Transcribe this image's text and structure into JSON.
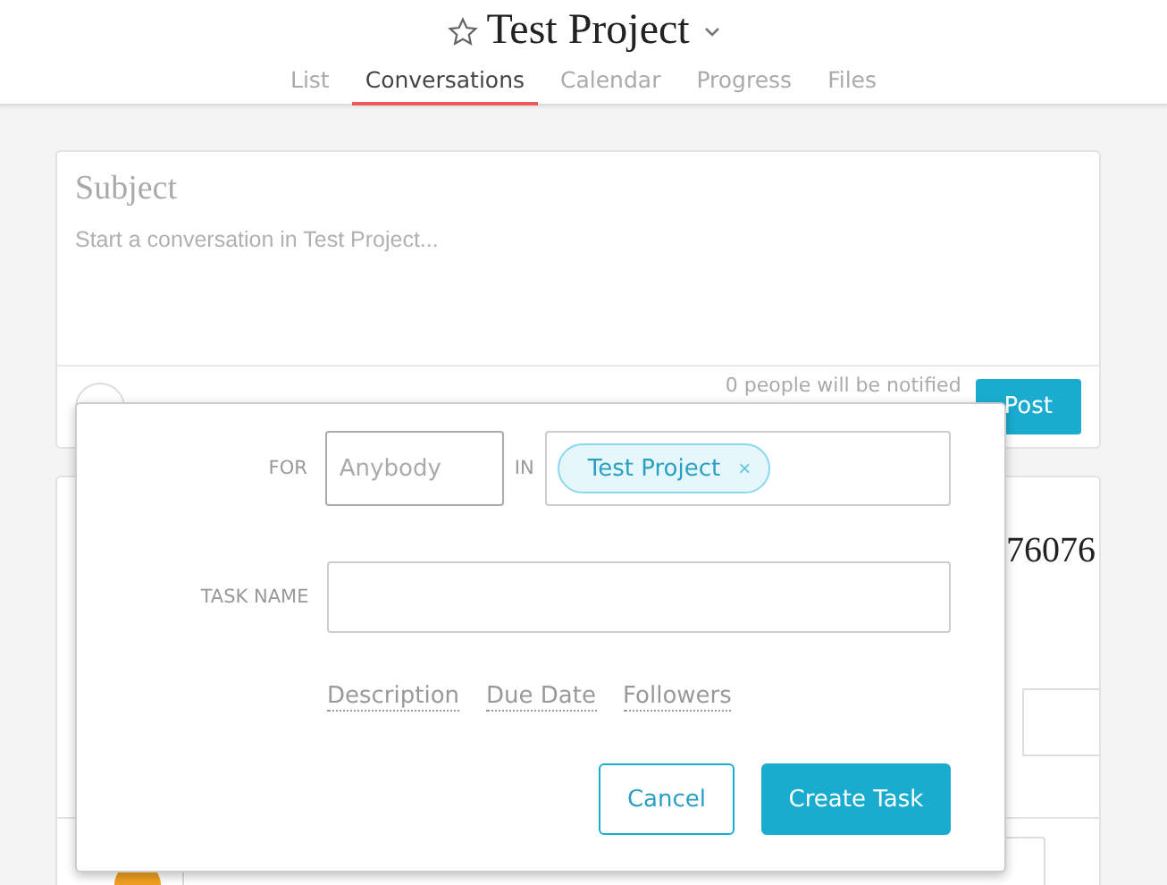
{
  "header": {
    "title": "Test Project",
    "tabs": [
      {
        "label": "List",
        "selected": false
      },
      {
        "label": "Conversations",
        "selected": true
      },
      {
        "label": "Calendar",
        "selected": false
      },
      {
        "label": "Progress",
        "selected": false
      },
      {
        "label": "Files",
        "selected": false
      }
    ]
  },
  "composer": {
    "subject_placeholder": "Subject",
    "body_placeholder": "Start a conversation in Test Project...",
    "notify_text": "0 people will be notified",
    "post_button": "Post"
  },
  "conversation": {
    "text_fragment": "76076"
  },
  "task_popup": {
    "for_label": "FOR",
    "assignee_placeholder": "Anybody",
    "in_label": "IN",
    "project_chip": "Test Project",
    "remove_symbol": "×",
    "task_name_label": "TASK NAME",
    "links": [
      "Description",
      "Due Date",
      "Followers"
    ],
    "buttons": [
      {
        "label": "Cancel",
        "kind": "secondary"
      },
      {
        "label": "Create Task",
        "kind": "primary"
      }
    ]
  }
}
